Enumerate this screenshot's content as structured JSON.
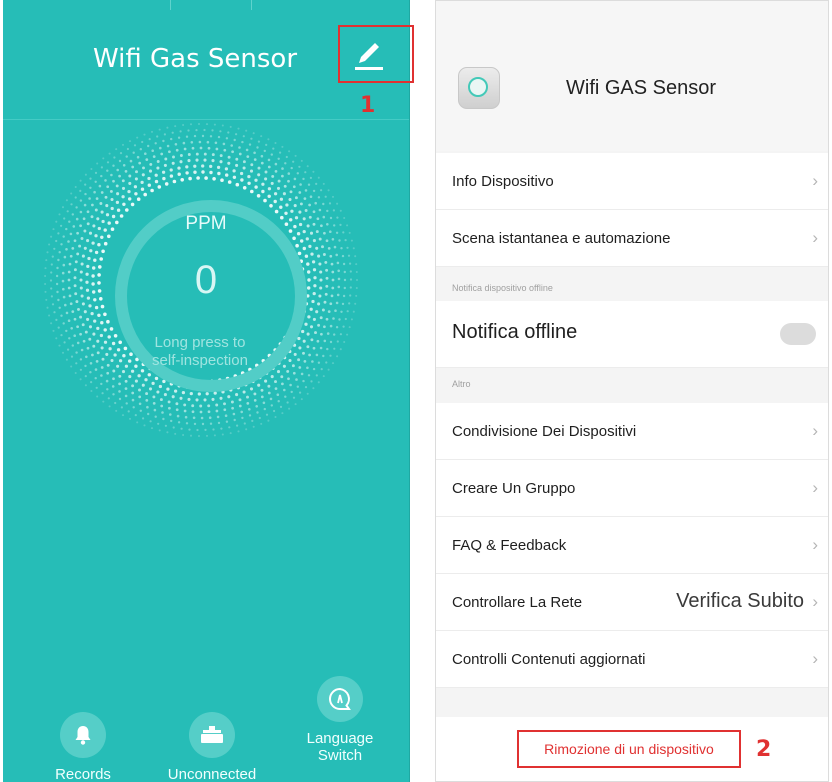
{
  "left_screen": {
    "title": "Wifi Gas Sensor",
    "edit_icon": "pencil-icon",
    "gauge": {
      "label": "PPM",
      "value": "0",
      "hint": "Long press to self-inspection"
    },
    "bottom_bar": [
      {
        "icon": "bell-icon",
        "label": "Records"
      },
      {
        "icon": "valve-icon",
        "label": "Unconnected"
      },
      {
        "icon": "chat-icon",
        "label": "Language Switch"
      }
    ],
    "colors": {
      "background": "#26bdb7",
      "accent": "#55cec8"
    }
  },
  "right_screen": {
    "device_name": "Wifi GAS Sensor",
    "items": {
      "info": "Info Dispositivo",
      "scene": "Scena istantanea e automazione",
      "offline_section": "Notifica dispositivo offline",
      "offline_toggle": "Notifica offline",
      "other_section": "Altro",
      "share": "Condivisione Dei Dispositivi",
      "group": "Creare Un Gruppo",
      "faq": "FAQ & Feedback",
      "network": "Controllare La Rete",
      "network_value": "Verifica Subito",
      "updates": "Controlli Contenuti aggiornati"
    },
    "remove_button": "Rimozione di un dispositivo",
    "offline_toggle_on": false
  },
  "callouts": {
    "one": "1",
    "two": "2",
    "color": "#e03131"
  }
}
